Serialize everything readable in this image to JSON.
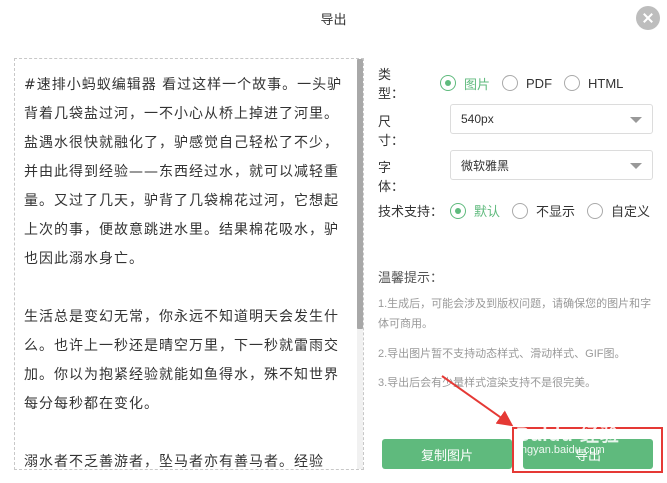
{
  "dialog": {
    "title": "导出"
  },
  "preview": {
    "paragraphs": [
      "#速排小蚂蚁编辑器 看过这样一个故事。一头驴背着几袋盐过河，一不小心从桥上掉进了河里。盐遇水很快就融化了，驴感觉自己轻松了不少，并由此得到经验——东西经过水，就可以减轻重量。又过了几天，驴背了几袋棉花过河，它想起上次的事，便故意跳进水里。结果棉花吸水，驴也因此溺水身亡。",
      "生活总是变幻无常，你永远不知道明天会发生什么。也许上一秒还是晴空万里，下一秒就雷雨交加。你以为抱紧经验就能如鱼得水，殊不知世界每分每秒都在变化。",
      "溺水者不乏善游者，坠马者亦有善马者。经验"
    ]
  },
  "form": {
    "type": {
      "label": "类　　型：",
      "options": [
        "图片",
        "PDF",
        "HTML"
      ],
      "selected": "图片"
    },
    "size": {
      "label": "尺　　寸：",
      "value": "540px"
    },
    "font": {
      "label": "字　　体：",
      "value": "微软雅黑"
    },
    "tech": {
      "label": "技术支持：",
      "options": [
        "默认",
        "不显示",
        "自定义"
      ],
      "selected": "默认"
    }
  },
  "tips": {
    "title": "温馨提示：",
    "items": [
      "1.生成后，可能会涉及到版权问题，请确保您的图片和字体可商用。",
      "2.导出图片暂不支持动态样式、滑动样式、GIF图。",
      "3.导出后会有少量样式渲染支持不是很完美。"
    ]
  },
  "buttons": {
    "copy": "复制图片",
    "export": "导出"
  },
  "watermark": {
    "text": "Baidu 经验",
    "sub": "jingyan.baidu.com"
  },
  "colors": {
    "accent": "#5fba7d",
    "annotation": "#e53935"
  }
}
